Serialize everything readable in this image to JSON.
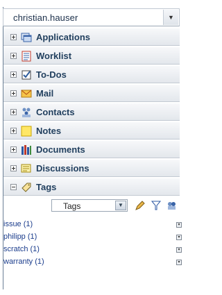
{
  "user": {
    "name": "christian.hauser"
  },
  "accordion": [
    {
      "label": "Applications"
    },
    {
      "label": "Worklist"
    },
    {
      "label": "To-Dos"
    },
    {
      "label": "Mail"
    },
    {
      "label": "Contacts"
    },
    {
      "label": "Notes"
    },
    {
      "label": "Documents"
    },
    {
      "label": "Discussions"
    },
    {
      "label": "Tags"
    }
  ],
  "tags_panel": {
    "select_value": "Tags",
    "items": [
      {
        "label": "issue (1)"
      },
      {
        "label": "philipp (1)"
      },
      {
        "label": "scratch (1)"
      },
      {
        "label": "warranty (1)"
      }
    ]
  },
  "colors": {
    "header_text": "#22405f",
    "tag_link": "#1a3c8c",
    "row_gradient_top": "#f7f8fa",
    "row_gradient_bottom": "#e3e7ec"
  }
}
